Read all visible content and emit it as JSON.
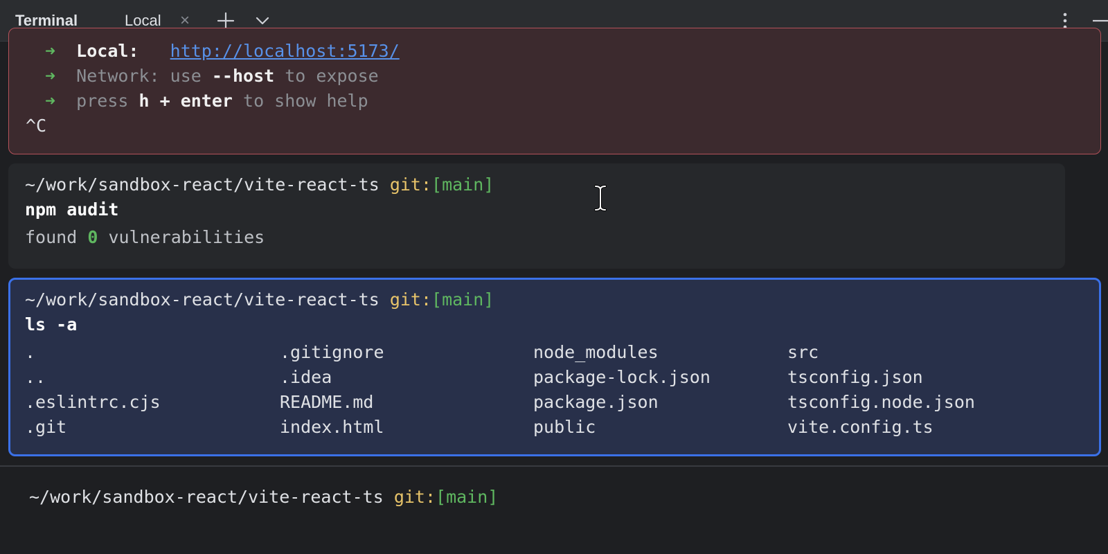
{
  "tabbar": {
    "title": "Terminal",
    "tabs": [
      {
        "label": "Local",
        "close_icon": "close-icon",
        "active": true
      }
    ],
    "icons": [
      "plus-icon",
      "chevron-down-icon",
      "more-vertical-icon",
      "minimize-icon"
    ]
  },
  "colors": {
    "accent": "#3574f0",
    "error_block_bg": "#3c2a2e",
    "error_block_border": "#b4525a",
    "selected_block_bg": "#28304a",
    "git_label": "#e8c46a",
    "branch": "#5fb760"
  },
  "blocks": {
    "vite_output": {
      "lines": [
        {
          "arrow": "➜",
          "label": "Local:",
          "value": "http://localhost:5173/"
        },
        {
          "arrow": "➜",
          "label": "Network:",
          "pre": "use",
          "bold": "--host",
          "post": "to expose"
        },
        {
          "arrow": "➜",
          "pre": "press",
          "bold": "h + enter",
          "post": "to show help"
        }
      ],
      "interrupt": "^C"
    },
    "audit": {
      "path": "~/work/sandbox-react/vite-react-ts",
      "git_label": "git:",
      "branch": "[main]",
      "command": "npm audit",
      "output_pre": "found",
      "output_num": "0",
      "output_post": "vulnerabilities"
    },
    "ls": {
      "path": "~/work/sandbox-react/vite-react-ts",
      "git_label": "git:",
      "branch": "[main]",
      "command": "ls -a",
      "columns": [
        [
          ".",
          "..",
          ".eslintrc.cjs",
          ".git"
        ],
        [
          ".gitignore",
          ".idea",
          "README.md",
          "index.html"
        ],
        [
          "node_modules",
          "package-lock.json",
          "package.json",
          "public"
        ],
        [
          "src",
          "tsconfig.json",
          "tsconfig.node.json",
          "vite.config.ts"
        ]
      ]
    }
  },
  "prompt": {
    "path": "~/work/sandbox-react/vite-react-ts",
    "git_label": "git:",
    "branch": "[main]"
  }
}
